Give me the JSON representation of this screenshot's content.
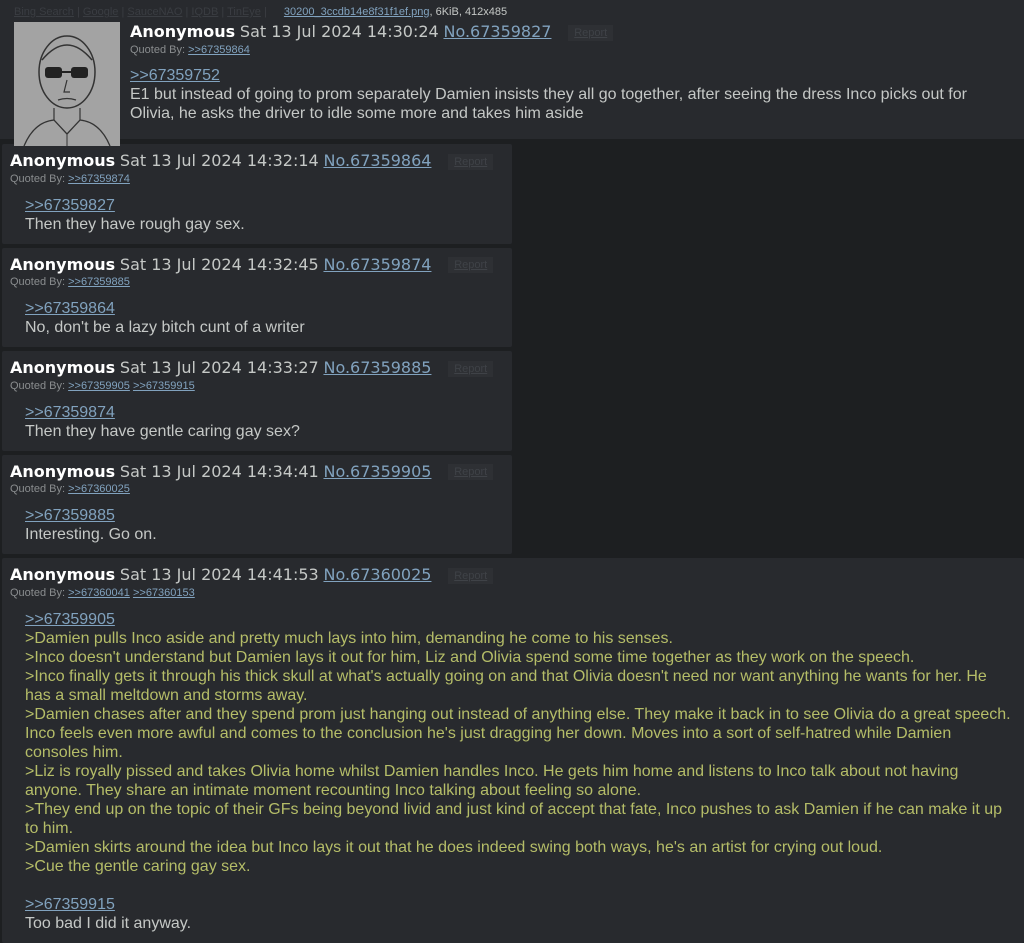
{
  "op": {
    "toolbar": [
      "Bing Search",
      "Google",
      "SauceNAO",
      "IQDB",
      "TinEye"
    ],
    "file_name": "30200_3ccdb14e8f31f1ef.png",
    "file_meta": ", 6KiB, 412x485",
    "name": "Anonymous",
    "date": "Sat 13 Jul 2024 14:30:24",
    "no": "No.67359827",
    "report": "Report",
    "quoted_label": "Quoted By:",
    "quoted": [
      ">>67359864"
    ],
    "quote_link": ">>67359752",
    "text": "E1 but instead of going to prom separately Damien insists they all go together, after seeing the dress Inco picks out for Olivia, he asks the driver to idle some more and takes him aside"
  },
  "replies": [
    {
      "name": "Anonymous",
      "date": "Sat 13 Jul 2024 14:32:14",
      "no": "No.67359864",
      "report": "Report",
      "quoted_label": "Quoted By:",
      "quoted": [
        ">>67359874"
      ],
      "quote_link": ">>67359827",
      "text": "Then they have rough gay sex."
    },
    {
      "name": "Anonymous",
      "date": "Sat 13 Jul 2024 14:32:45",
      "no": "No.67359874",
      "report": "Report",
      "quoted_label": "Quoted By:",
      "quoted": [
        ">>67359885"
      ],
      "quote_link": ">>67359864",
      "text": "No, don't be a lazy bitch cunt of a writer"
    },
    {
      "name": "Anonymous",
      "date": "Sat 13 Jul 2024 14:33:27",
      "no": "No.67359885",
      "report": "Report",
      "quoted_label": "Quoted By:",
      "quoted": [
        ">>67359905",
        ">>67359915"
      ],
      "quote_link": ">>67359874",
      "text": "Then they have gentle caring gay sex?"
    },
    {
      "name": "Anonymous",
      "date": "Sat 13 Jul 2024 14:34:41",
      "no": "No.67359905",
      "report": "Report",
      "quoted_label": "Quoted By:",
      "quoted": [
        ">>67360025"
      ],
      "quote_link": ">>67359885",
      "text": "Interesting. Go on."
    },
    {
      "name": "Anonymous",
      "date": "Sat 13 Jul 2024 14:41:53",
      "no": "No.67360025",
      "report": "Report",
      "quoted_label": "Quoted By:",
      "quoted": [
        ">>67360041",
        ">>67360153"
      ],
      "quote_link": ">>67359905",
      "greentext": [
        ">Damien pulls Inco aside and pretty much lays into him, demanding he come to his senses.",
        ">Inco doesn't understand but Damien lays it out for him, Liz and Olivia spend some time together as they work on the speech.",
        ">Inco finally gets it through his thick skull at what's actually going on and that Olivia doesn't need nor want anything he wants for her. He has a small meltdown and storms away.",
        ">Damien chases after and they spend prom just hanging out instead of anything else. They make it back in to see Olivia do a great speech. Inco feels even more awful and comes to the conclusion he's just dragging her down. Moves into a sort of self-hatred while Damien consoles him.",
        ">Liz is royally pissed and takes Olivia home whilst Damien handles Inco. He gets him home and listens to Inco talk about not having anyone. They share an intimate moment recounting Inco talking about feeling so alone.",
        ">They end up on the topic of their GFs being beyond livid and just kind of accept that fate, Inco pushes to ask Damien if he can make it up to him.",
        ">Damien skirts around the idea but Inco lays it out that he does indeed swing both ways, he's an artist for crying out loud.",
        ">Cue the gentle caring gay sex."
      ],
      "quote_link_2": ">>67359915",
      "text_2": "Too bad I did it anyway."
    }
  ]
}
